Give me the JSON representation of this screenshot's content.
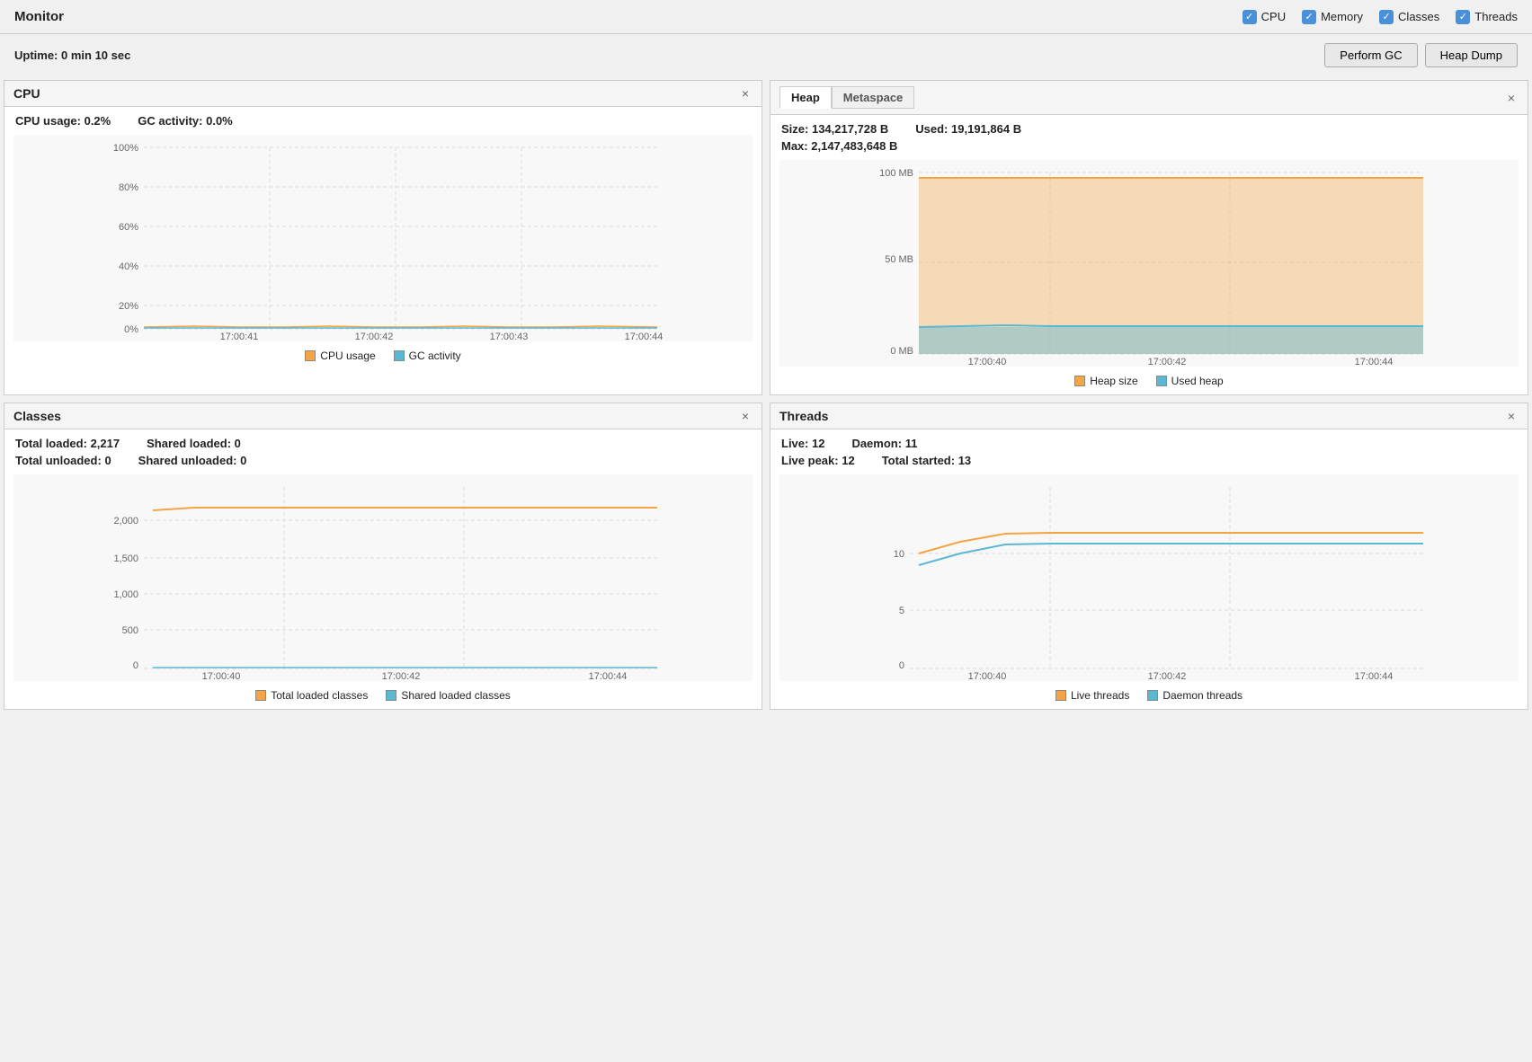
{
  "header": {
    "title": "Monitor",
    "checkboxes": [
      {
        "label": "CPU",
        "checked": true
      },
      {
        "label": "Memory",
        "checked": true
      },
      {
        "label": "Classes",
        "checked": true
      },
      {
        "label": "Threads",
        "checked": true
      }
    ]
  },
  "subheader": {
    "uptime_label": "Uptime:",
    "uptime_value": "0 min 10 sec",
    "btn_gc": "Perform GC",
    "btn_heap_dump": "Heap Dump"
  },
  "cpu_panel": {
    "title": "CPU",
    "cpu_usage_label": "CPU usage:",
    "cpu_usage_value": "0.2%",
    "gc_activity_label": "GC activity:",
    "gc_activity_value": "0.0%",
    "x_labels": [
      "17:00:41",
      "17:00:42",
      "17:00:43",
      "17:00:44"
    ],
    "y_labels": [
      "100%",
      "80%",
      "60%",
      "40%",
      "20%",
      "0%"
    ],
    "legend_cpu": "CPU usage",
    "legend_gc": "GC activity"
  },
  "heap_panel": {
    "tab_heap": "Heap",
    "tab_metaspace": "Metaspace",
    "size_label": "Size:",
    "size_value": "134,217,728 B",
    "used_label": "Used:",
    "used_value": "19,191,864 B",
    "max_label": "Max:",
    "max_value": "2,147,483,648 B",
    "x_labels": [
      "17:00:40",
      "17:00:42",
      "17:00:44"
    ],
    "y_labels": [
      "100 MB",
      "50 MB",
      "0 MB"
    ],
    "legend_size": "Heap size",
    "legend_used": "Used heap"
  },
  "classes_panel": {
    "title": "Classes",
    "total_loaded_label": "Total loaded:",
    "total_loaded_value": "2,217",
    "shared_loaded_label": "Shared loaded:",
    "shared_loaded_value": "0",
    "total_unloaded_label": "Total unloaded:",
    "total_unloaded_value": "0",
    "shared_unloaded_label": "Shared unloaded:",
    "shared_unloaded_value": "0",
    "x_labels": [
      "17:00:40",
      "17:00:42",
      "17:00:44"
    ],
    "y_labels": [
      "2,000",
      "1,500",
      "1,000",
      "500",
      "0"
    ],
    "legend_total": "Total loaded classes",
    "legend_shared": "Shared loaded classes"
  },
  "threads_panel": {
    "title": "Threads",
    "live_label": "Live:",
    "live_value": "12",
    "daemon_label": "Daemon:",
    "daemon_value": "11",
    "live_peak_label": "Live peak:",
    "live_peak_value": "12",
    "total_started_label": "Total started:",
    "total_started_value": "13",
    "x_labels": [
      "17:00:40",
      "17:00:42",
      "17:00:44"
    ],
    "y_labels": [
      "10",
      "5",
      "0"
    ],
    "legend_live": "Live threads",
    "legend_daemon": "Daemon threads"
  }
}
